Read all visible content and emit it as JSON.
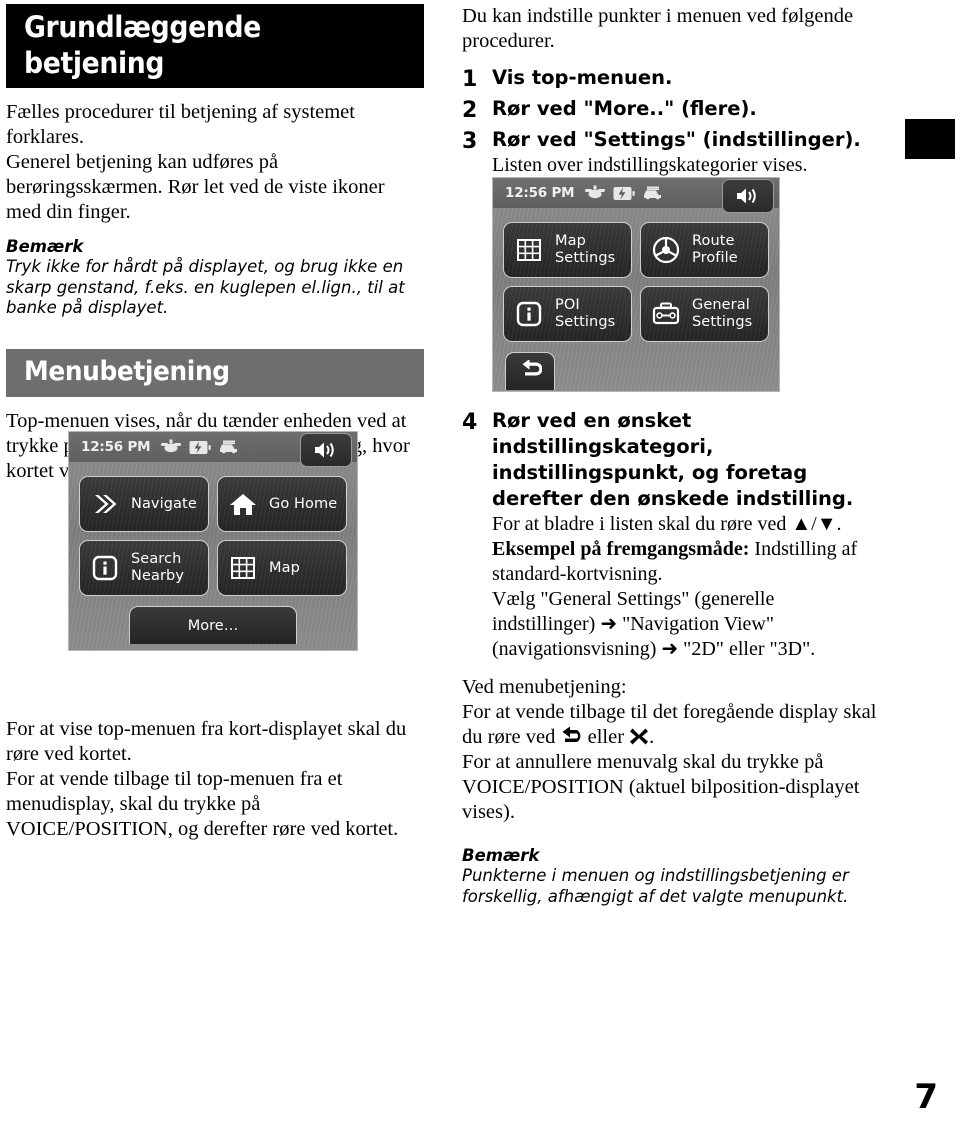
{
  "page": {
    "number": "7",
    "tab_marker_color": "#000000"
  },
  "left_column": {
    "section1": {
      "heading": "Grundlæggende betjening",
      "heading_bg": "#000000",
      "paragraphs": [
        "Fælles procedurer til betjening af systemet forklares.",
        "Generel betjening kan udføres på berøringsskærmen. Rør let ved de viste ikoner med din finger."
      ],
      "note_title": "Bemærk",
      "note_body": "Tryk ikke for hårdt på displayet, og brug ikke en skarp genstand, f.eks. en kuglepen el.lign., til at banke på displayet."
    },
    "section2": {
      "heading": "Menubetjening",
      "heading_bg": "#6e6e6e",
      "intro": "Top-menuen vises, når du tænder enheden ved at trykke på I/⏻ (undtagen ved rutevejledning, hvor kortet vises).",
      "after_image": [
        "For at vise top-menuen fra kort-displayet skal du røre ved kortet.",
        "For at vende tilbage til top-menuen fra et menudisplay, skal du trykke på VOICE/POSITION, og derefter røre ved kortet."
      ]
    }
  },
  "right_column": {
    "intro": "Du kan indstille punkter i menuen ved følgende procedurer.",
    "steps": [
      {
        "num": "1",
        "head": "Vis top-menuen.",
        "sub": ""
      },
      {
        "num": "2",
        "head": "Rør ved \"More..\" (flere).",
        "sub": ""
      },
      {
        "num": "3",
        "head": "Rør ved \"Settings\" (indstillinger).",
        "sub": "Listen over indstillingskategorier vises."
      }
    ],
    "step4": {
      "num": "4",
      "head": "Rør ved en ønsket indstillingskategori, indstillingspunkt, og foretag derefter den ønskede indstilling.",
      "line_scroll": "For at bladre i listen skal du røre ved ▲/▼.",
      "example_label": "Eksempel på fremgangsmåde:",
      "example_text": " Indstilling af standard-kortvisning.",
      "path_line": "Vælg \"General Settings\" (generelle indstillinger) ➜  \"Navigation View\" (navigationsvisning) ➜ \"2D\" eller \"3D\"."
    },
    "menu_ops": {
      "title": "Ved menubetjening:",
      "line1_a": "For at vende tilbage til det foregående display skal du røre ved ",
      "line1_b": " eller ",
      "line1_c": ".",
      "line2": "For at annullere menuvalg skal du trykke på VOICE/POSITION (aktuel bilposition-displayet vises)."
    },
    "note_title": "Bemærk",
    "note_body": "Punkterne i menuen og indstillingsbetjening er forskellig, afhængigt af det valgte menupunkt."
  },
  "device_topmenu": {
    "clock": "12:56 PM",
    "status_icons": [
      "satellite-icon",
      "battery-charging-icon",
      "traffic-car-icon"
    ],
    "speaker_icon": "speaker-icon",
    "buttons": [
      {
        "icon": "chevron-double-right-icon",
        "label": "Navigate"
      },
      {
        "icon": "home-icon",
        "label": "Go Home"
      },
      {
        "icon": "info-icon",
        "label": "Search\nNearby"
      },
      {
        "icon": "map-grid-icon",
        "label": "Map"
      }
    ],
    "more_label": "More…"
  },
  "device_settings": {
    "clock": "12:56 PM",
    "status_icons": [
      "satellite-icon",
      "battery-charging-icon",
      "traffic-car-icon"
    ],
    "speaker_icon": "speaker-icon",
    "buttons": [
      {
        "icon": "map-grid-icon",
        "label": "Map\nSettings"
      },
      {
        "icon": "steering-wheel-icon",
        "label": "Route\nProfile"
      },
      {
        "icon": "info-icon",
        "label": "POI Settings"
      },
      {
        "icon": "toolbox-icon",
        "label": "General\nSettings"
      }
    ],
    "back_icon": "back-arrow-icon"
  }
}
